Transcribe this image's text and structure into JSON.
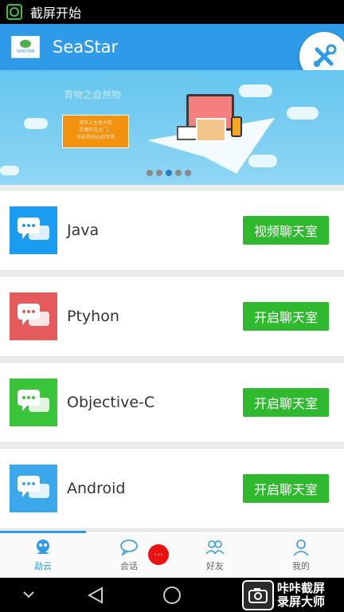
{
  "status_bar": {
    "text": "截屏开始"
  },
  "app_bar": {
    "title": "SeaStar",
    "logo_text": "SEASTAR",
    "accent": "#2e9ae8"
  },
  "banner": {
    "caption": "青物之自然物",
    "promo_lines": [
      "海天上生命力的",
      "灵魂开启之门，",
      "开启你内心的世界"
    ],
    "active_slide": 3,
    "slide_count": 5
  },
  "list": {
    "items": [
      {
        "label": "Java",
        "button": "视频聊天室",
        "icon": "chat-icon",
        "color": "#1a9cf0"
      },
      {
        "label": "Ptyhon",
        "button": "开启聊天室",
        "icon": "chat-icon",
        "color": "#e55a5a"
      },
      {
        "label": "Objective-C",
        "button": "开启聊天室",
        "icon": "chat-icon",
        "color": "#3ac43a"
      },
      {
        "label": "Android",
        "button": "开启聊天室",
        "icon": "chat-icon",
        "color": "#3aa8ea"
      }
    ],
    "button_color": "#2fb92f"
  },
  "bottom_nav": {
    "tabs": [
      {
        "label": "勐云",
        "icon": "cloud-person-icon"
      },
      {
        "label": "会话",
        "icon": "speech-bubble-icon"
      },
      {
        "label": "好友",
        "icon": "friends-icon"
      },
      {
        "label": "我的",
        "icon": "profile-icon"
      }
    ],
    "active_index": 0,
    "badge_text": "···"
  },
  "watermark": {
    "line1": "咔咔截屏",
    "line2": "录屏大师"
  }
}
